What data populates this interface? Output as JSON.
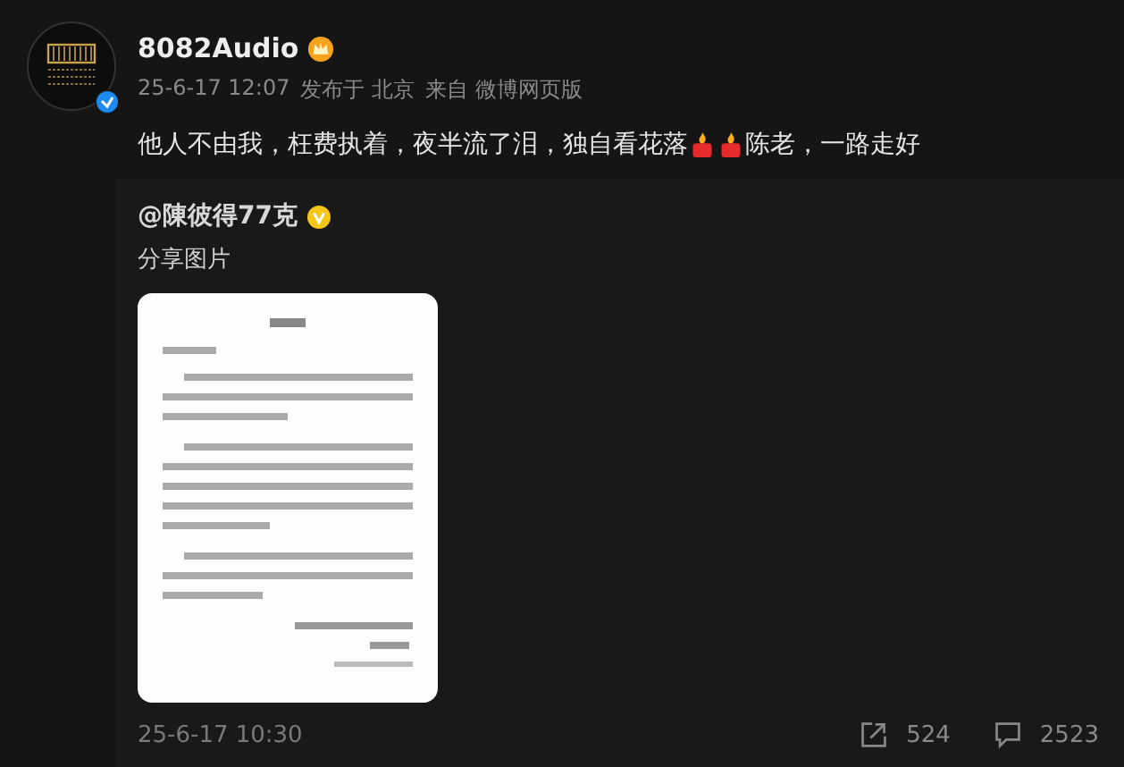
{
  "post": {
    "author": "8082Audio",
    "meta": [
      "25-6-17 12:07",
      "发布于 北京",
      "来自 微博网页版"
    ],
    "text_before": "他人不由我，枉费执着，夜半流了泪，独自看花落",
    "text_after": "陈老，一路走好",
    "repost": {
      "author": "@陳彼得77克",
      "text": "分享图片",
      "time": "25-6-17 10:30",
      "shares": "524",
      "comments": "2523"
    }
  }
}
